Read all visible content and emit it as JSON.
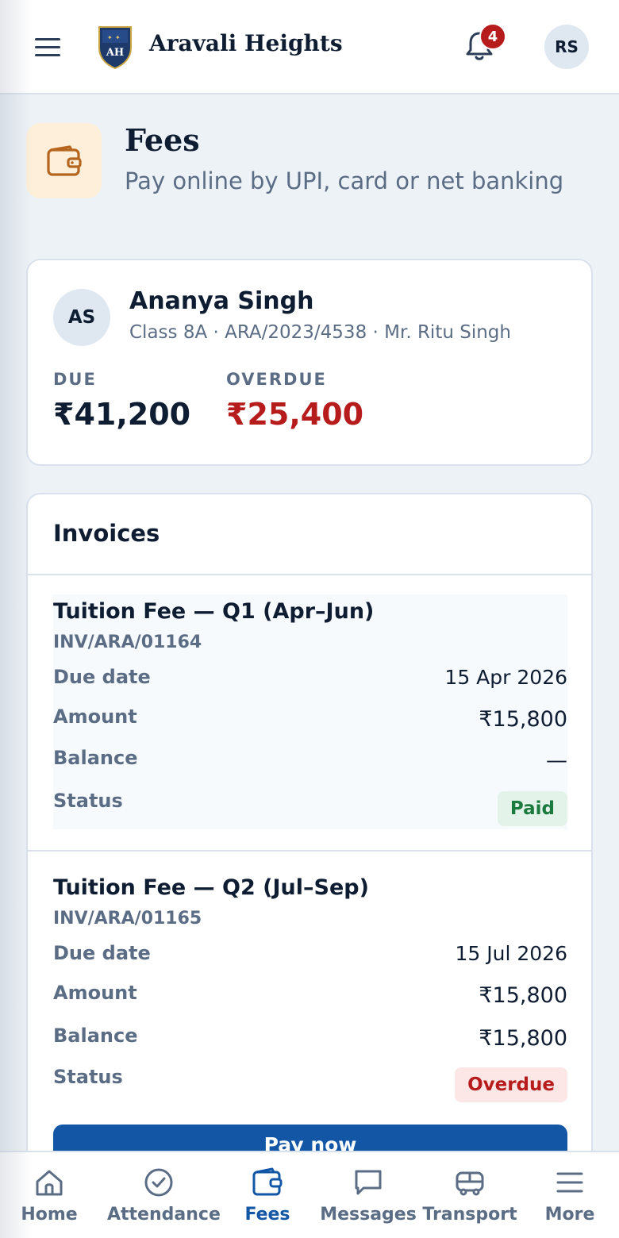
{
  "header": {
    "logo_text": "AH",
    "brand": "Aravali Heights",
    "notification_count": "4",
    "user_initials": "RS"
  },
  "page": {
    "title": "Fees",
    "subtitle": "Pay online by UPI, card or net banking"
  },
  "student": {
    "initials": "AS",
    "name": "Ananya Singh",
    "meta": "Class 8A · ARA/2023/4538 · Mr. Ritu Singh",
    "due_label": "DUE",
    "due_value": "₹41,200",
    "overdue_label": "OVERDUE",
    "overdue_value": "₹25,400"
  },
  "invoices": {
    "heading": "Invoices",
    "row_labels": {
      "due_date": "Due date",
      "amount": "Amount",
      "balance": "Balance",
      "status": "Status"
    },
    "items": [
      {
        "title": "Tuition Fee — Q1 (Apr–Jun)",
        "number": "INV/ARA/01164",
        "due_date": "15 Apr 2026",
        "amount": "₹15,800",
        "balance": "—",
        "status": "Paid"
      },
      {
        "title": "Tuition Fee — Q2 (Jul–Sep)",
        "number": "INV/ARA/01165",
        "due_date": "15 Jul 2026",
        "amount": "₹15,800",
        "balance": "₹15,800",
        "status": "Overdue",
        "action": "Pay now"
      }
    ]
  },
  "nav": {
    "items": [
      {
        "label": "Home",
        "icon": "home-icon"
      },
      {
        "label": "Attendance",
        "icon": "check-circle-icon"
      },
      {
        "label": "Fees",
        "icon": "wallet-icon",
        "active": true
      },
      {
        "label": "Messages",
        "icon": "chat-icon"
      },
      {
        "label": "Transport",
        "icon": "bus-icon"
      },
      {
        "label": "More",
        "icon": "menu-icon"
      }
    ]
  },
  "colors": {
    "primary": "#1356a6",
    "danger": "#b71c1c",
    "success": "#1b7a3d",
    "text": "#0f1d33",
    "muted": "#5b6d85",
    "fees_icon_bg": "#fdefd9",
    "fees_icon": "#b5651d"
  }
}
